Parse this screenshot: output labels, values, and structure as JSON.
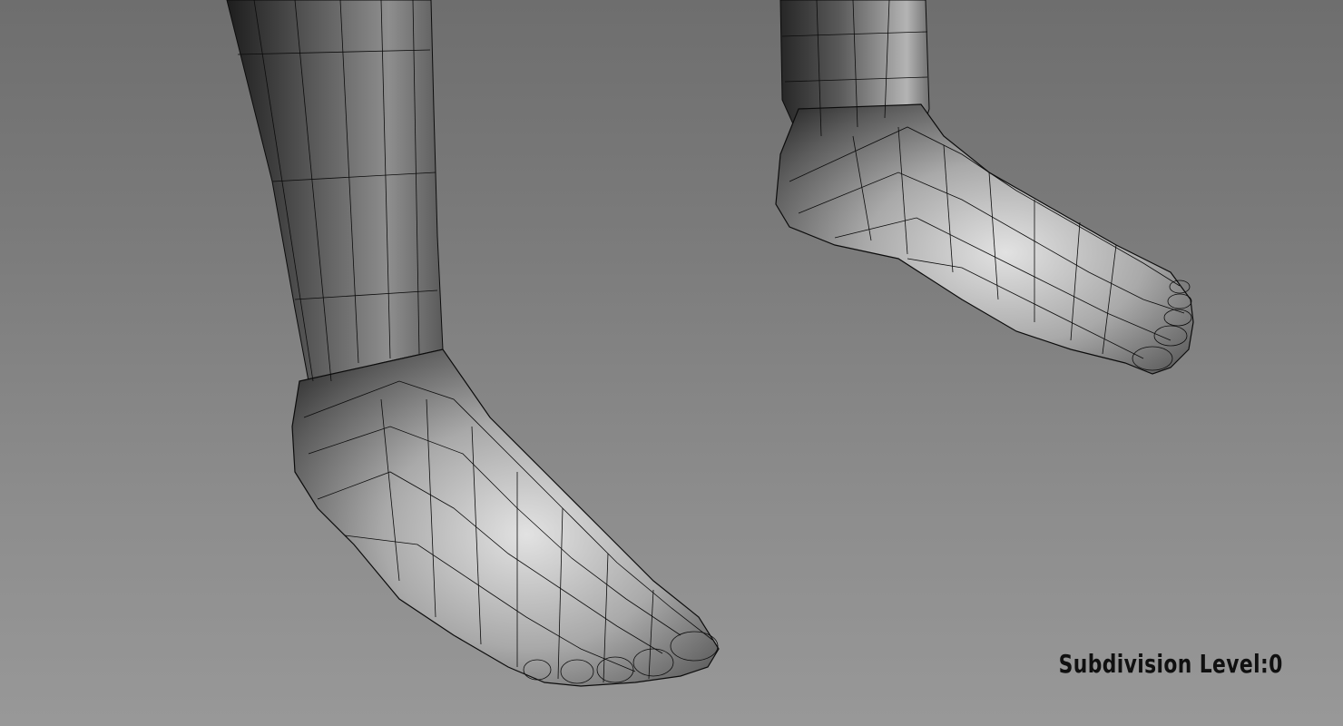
{
  "viewport": {
    "background_top": "#6e6e6e",
    "background_bottom": "#989898",
    "wire_color": "#0c0c0c"
  },
  "overlay": {
    "subdivision_label": "Subdivision Level:0"
  }
}
